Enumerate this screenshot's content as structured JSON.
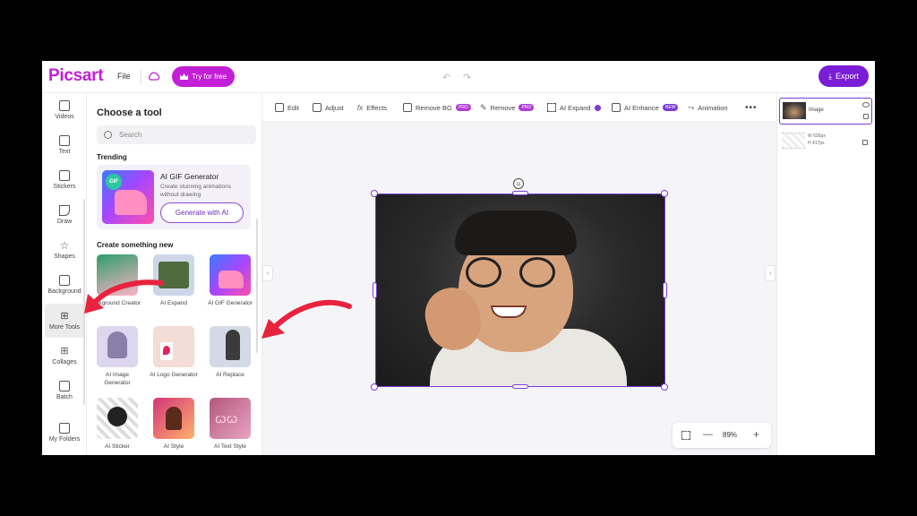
{
  "topbar": {
    "logo": "Picsart",
    "file_menu": "File",
    "try_button": "Try for free",
    "export_button": "Export"
  },
  "rail": {
    "items": [
      {
        "label": "Videos",
        "icon": "video-icon"
      },
      {
        "label": "Text",
        "icon": "text-icon"
      },
      {
        "label": "Stickers",
        "icon": "sticker-icon"
      },
      {
        "label": "Draw",
        "icon": "brush-icon"
      },
      {
        "label": "Shapes",
        "icon": "star-icon"
      },
      {
        "label": "Background",
        "icon": "background-icon"
      },
      {
        "label": "More Tools",
        "icon": "more-tools-icon"
      },
      {
        "label": "Collages",
        "icon": "collage-icon"
      },
      {
        "label": "Batch",
        "icon": "batch-icon"
      },
      {
        "label": "My Folders",
        "icon": "folder-icon"
      }
    ],
    "active": "More Tools"
  },
  "panel": {
    "title": "Choose a tool",
    "search_placeholder": "Search",
    "trending_label": "Trending",
    "trending": {
      "name": "AI GIF Generator",
      "description": "Create stunning animations without drawing",
      "button": "Generate with AI",
      "badge": "GIF"
    },
    "create_label": "Create something new",
    "tools": [
      {
        "label": "Background Creator",
        "visible_label": "...kground Creator"
      },
      {
        "label": "AI Expand"
      },
      {
        "label": "AI GIF Generator"
      },
      {
        "label": "AI Image Generator"
      },
      {
        "label": "AI Logo Generator"
      },
      {
        "label": "AI Replace"
      },
      {
        "label": "AI Sticker"
      },
      {
        "label": "AI Style"
      },
      {
        "label": "AI Text Style"
      }
    ]
  },
  "toolbar": {
    "items": [
      {
        "label": "Edit",
        "icon": "edit-icon"
      },
      {
        "label": "Adjust",
        "icon": "adjust-icon"
      },
      {
        "label": "Effects",
        "icon": "fx-icon"
      },
      {
        "label": "Remove BG",
        "icon": "remove-bg-icon",
        "badge": "PRO"
      },
      {
        "label": "Remove",
        "icon": "eraser-icon",
        "badge": "PRO"
      },
      {
        "label": "AI Expand",
        "icon": "expand-icon",
        "badge": "dot"
      },
      {
        "label": "AI Enhance",
        "icon": "enhance-icon",
        "badge": "NEW"
      },
      {
        "label": "Animation",
        "icon": "animation-icon"
      },
      {
        "label": "•••",
        "icon": "more-icon"
      }
    ]
  },
  "zoom": {
    "value": "89%"
  },
  "layers": {
    "items": [
      {
        "name": "Image"
      },
      {
        "width": "W 626px",
        "height": "H 417px"
      }
    ]
  },
  "colors": {
    "brand": "#c21fd6",
    "accent": "#7a1dd6",
    "annotation_arrow": "#e8233f"
  }
}
